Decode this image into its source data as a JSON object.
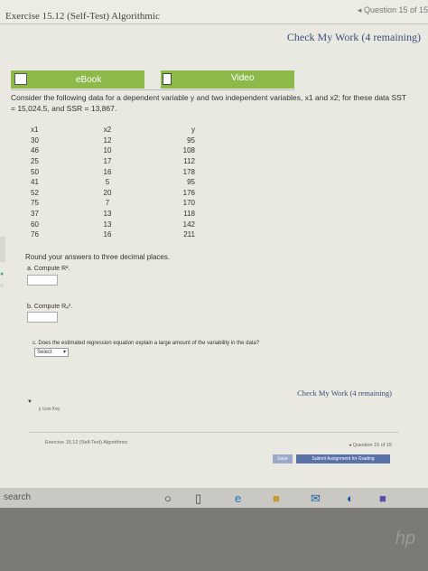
{
  "header": {
    "exercise_title": "Exercise 15.12 (Self-Test) Algorithmic",
    "question_nav": "◂ Question 15 of 15",
    "check_my_work": "Check My Work (4 remaining)"
  },
  "tabs": [
    {
      "label": "eBook"
    },
    {
      "label": "Video"
    }
  ],
  "prompt": {
    "line1": "Consider the following data for a dependent variable y and two independent variables, x1 and x2; for these data SST",
    "line2": "= 15,024.5, and SSR = 13,867."
  },
  "table": {
    "headers": [
      "x1",
      "x2",
      "y"
    ],
    "rows": [
      [
        "30",
        "12",
        "95"
      ],
      [
        "46",
        "10",
        "108"
      ],
      [
        "25",
        "17",
        "112"
      ],
      [
        "50",
        "16",
        "178"
      ],
      [
        "41",
        "5",
        "95"
      ],
      [
        "52",
        "20",
        "176"
      ],
      [
        "75",
        "7",
        "170"
      ],
      [
        "37",
        "13",
        "118"
      ],
      [
        "60",
        "13",
        "142"
      ],
      [
        "76",
        "16",
        "211"
      ]
    ]
  },
  "instructions": {
    "round_note": "Round your answers to three decimal places."
  },
  "questions": {
    "a_label": "a. Compute R².",
    "b_label": "b. Compute Rₐ².",
    "c_label": "c. Does the estimated regression equation explain a large amount of the variability in the data?",
    "select_value": "Select"
  },
  "footer": {
    "check_my_work": "Check My Work (4 remaining)",
    "icon_key": "Icon Key",
    "exercise_title": "Exercise 15.12 (Self-Test) Algorithmic",
    "question_nav": "◂ Question 15 of 15",
    "save_label": "Save",
    "submit_label": "Submit Assignment for Grading"
  },
  "taskbar": {
    "search_text": "search"
  },
  "colors": {
    "tab_green": "#8db94b",
    "link_blue": "#3d4f7a",
    "submit_blue": "#5a72a8"
  }
}
